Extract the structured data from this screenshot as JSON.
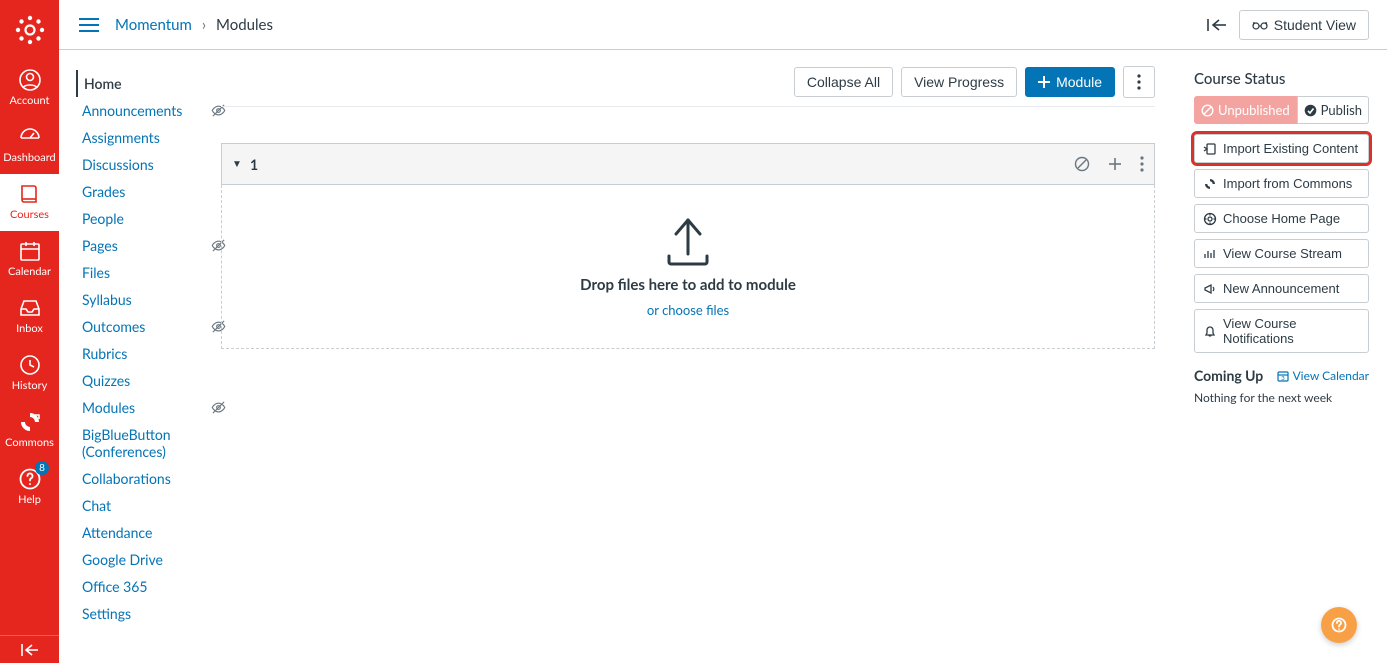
{
  "globalNav": {
    "items": [
      {
        "label": "Account",
        "icon": "user"
      },
      {
        "label": "Dashboard",
        "icon": "dashboard"
      },
      {
        "label": "Courses",
        "icon": "book",
        "active": true
      },
      {
        "label": "Calendar",
        "icon": "calendar"
      },
      {
        "label": "Inbox",
        "icon": "inbox"
      },
      {
        "label": "History",
        "icon": "clock"
      },
      {
        "label": "Commons",
        "icon": "commons"
      },
      {
        "label": "Help",
        "icon": "help",
        "badge": "8"
      }
    ]
  },
  "breadcrumb": {
    "course": "Momentum",
    "page": "Modules"
  },
  "topbar": {
    "studentView": "Student View"
  },
  "courseNav": {
    "items": [
      {
        "label": "Home",
        "active": true
      },
      {
        "label": "Announcements",
        "hidden": true
      },
      {
        "label": "Assignments"
      },
      {
        "label": "Discussions"
      },
      {
        "label": "Grades"
      },
      {
        "label": "People"
      },
      {
        "label": "Pages",
        "hidden": true
      },
      {
        "label": "Files"
      },
      {
        "label": "Syllabus"
      },
      {
        "label": "Outcomes",
        "hidden": true
      },
      {
        "label": "Rubrics"
      },
      {
        "label": "Quizzes"
      },
      {
        "label": "Modules",
        "hidden": true
      },
      {
        "label": "BigBlueButton (Conferences)"
      },
      {
        "label": "Collaborations"
      },
      {
        "label": "Chat"
      },
      {
        "label": "Attendance"
      },
      {
        "label": "Google Drive"
      },
      {
        "label": "Office 365"
      },
      {
        "label": "Settings"
      }
    ]
  },
  "mainActions": {
    "collapseAll": "Collapse All",
    "viewProgress": "View Progress",
    "addModule": "Module"
  },
  "module": {
    "title": "1",
    "dropText": "Drop files here to add to module",
    "chooseLink": "or choose files"
  },
  "aside": {
    "statusTitle": "Course Status",
    "unpublished": "Unpublished",
    "publish": "Publish",
    "buttons": [
      {
        "label": "Import Existing Content",
        "highlight": true,
        "icon": "import"
      },
      {
        "label": "Import from Commons",
        "icon": "commons-sm"
      },
      {
        "label": "Choose Home Page",
        "icon": "home"
      },
      {
        "label": "View Course Stream",
        "icon": "stream"
      },
      {
        "label": "New Announcement",
        "icon": "announce"
      },
      {
        "label": "View Course Notifications",
        "icon": "bell"
      }
    ],
    "comingUp": "Coming Up",
    "viewCalendar": "View Calendar",
    "nothing": "Nothing for the next week"
  }
}
